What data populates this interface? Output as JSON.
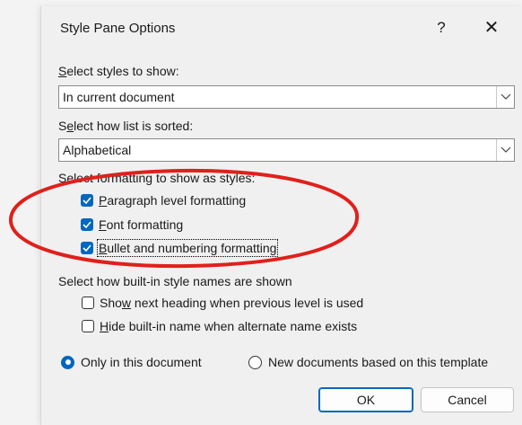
{
  "dialog": {
    "title": "Style Pane Options",
    "help_label": "?",
    "close_label": "✕"
  },
  "styles_to_show": {
    "label_u": "S",
    "label_rest": "elect styles to show:",
    "value": "In current document"
  },
  "sort": {
    "label_pre": "S",
    "label_u": "e",
    "label_rest": "lect how list is sorted:",
    "value": "Alphabetical"
  },
  "formatting": {
    "label": "Select formatting to show as styles:",
    "paragraph": {
      "u": "P",
      "rest": "aragraph level formatting",
      "checked": true
    },
    "font": {
      "u": "F",
      "rest": "ont formatting",
      "checked": true
    },
    "bullet": {
      "u": "B",
      "rest": "ullet and numbering formatting",
      "checked": true
    }
  },
  "builtin": {
    "label": "Select how built-in style names are shown",
    "next_heading": {
      "pre": "Sho",
      "u": "w",
      "rest": " next heading when previous level is used",
      "checked": false
    },
    "hide_builtin": {
      "u": "H",
      "rest": "ide built-in name when alternate name exists",
      "checked": false
    }
  },
  "scope": {
    "only_doc": "Only in this document",
    "new_docs": "New documents based on this template",
    "selected": "only_doc"
  },
  "buttons": {
    "ok": "OK",
    "cancel": "Cancel"
  },
  "colors": {
    "accent": "#0067c0",
    "annotation": "#e0201b"
  }
}
